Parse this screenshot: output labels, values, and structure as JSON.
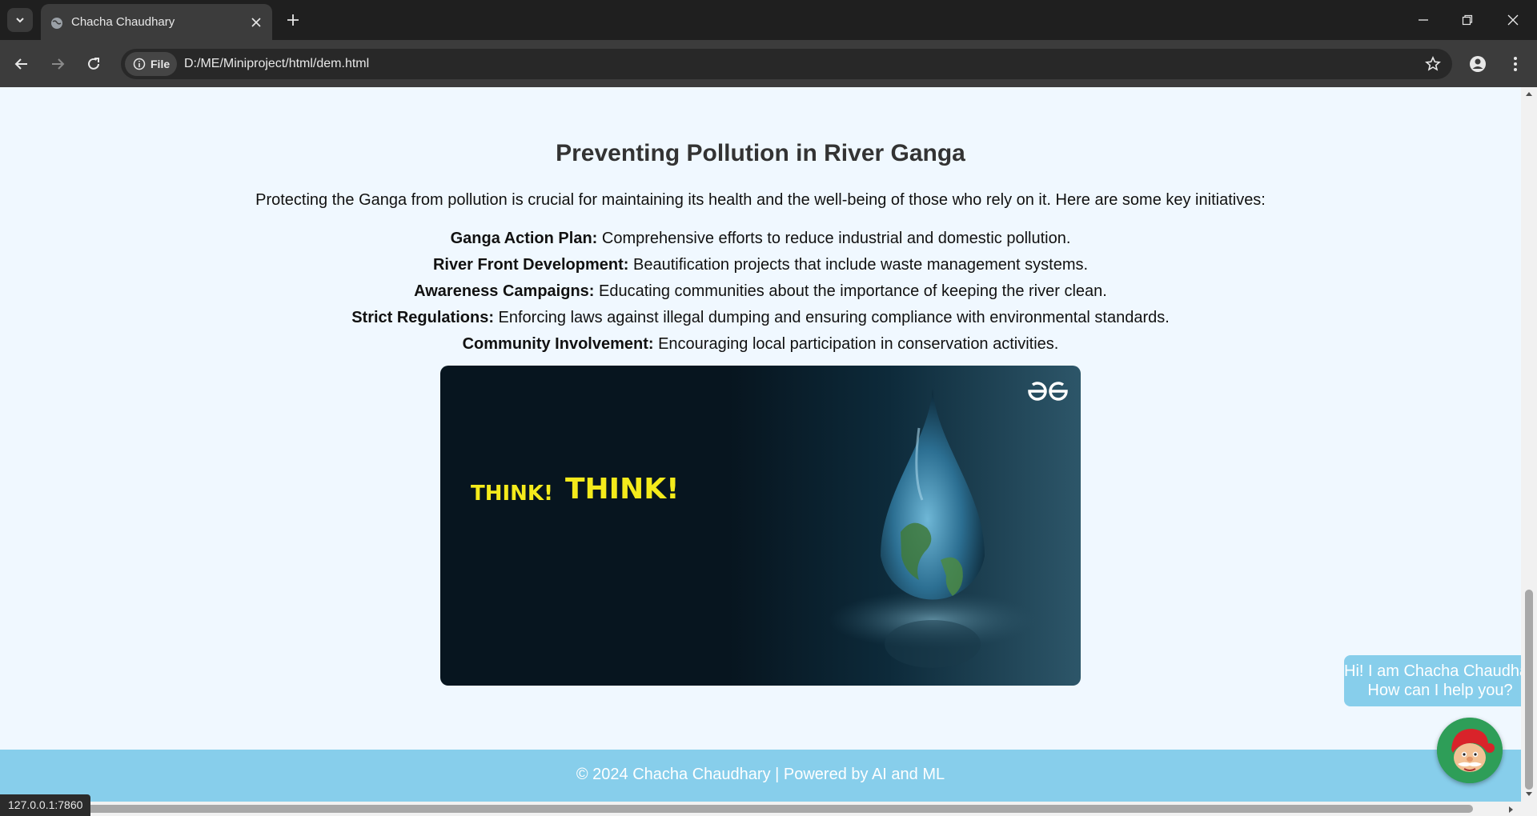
{
  "browser": {
    "tab_title": "Chacha Chaudhary",
    "site_chip": "File",
    "url": "D:/ME/Miniproject/html/dem.html",
    "status_url": "127.0.0.1:7860"
  },
  "page": {
    "heading": "Preventing Pollution in River Ganga",
    "intro": "Protecting the Ganga from pollution is crucial for maintaining its health and the well-being of those who rely on it. Here are some key initiatives:",
    "initiatives": [
      {
        "title": "Ganga Action Plan:",
        "text": " Comprehensive efforts to reduce industrial and domestic pollution."
      },
      {
        "title": "River Front Development:",
        "text": " Beautification projects that include waste management systems."
      },
      {
        "title": "Awareness Campaigns:",
        "text": " Educating communities about the importance of keeping the river clean."
      },
      {
        "title": "Strict Regulations:",
        "text": " Enforcing laws against illegal dumping and ensuring compliance with environmental standards."
      },
      {
        "title": "Community Involvement:",
        "text": " Encouraging local participation in conservation activities."
      }
    ],
    "banner": {
      "think_small": "THINK!",
      "think_big": "THINK!"
    },
    "footer": "© 2024 Chacha Chaudhary | Powered by AI and ML",
    "chat": {
      "line1": "Hi! I am Chacha Chaudhary",
      "line2": "How can I help you?"
    }
  },
  "colors": {
    "page_bg": "#f0f8ff",
    "accent": "#87ceeb",
    "think_yellow": "#f4ea1b",
    "chrome_dark": "#1f1f1f"
  },
  "icons": [
    "tab-search-icon",
    "globe-icon",
    "close-icon",
    "plus-icon",
    "minimize-icon",
    "restore-icon",
    "back-icon",
    "forward-icon",
    "reload-icon",
    "info-icon",
    "star-icon",
    "profile-icon",
    "more-icon"
  ]
}
